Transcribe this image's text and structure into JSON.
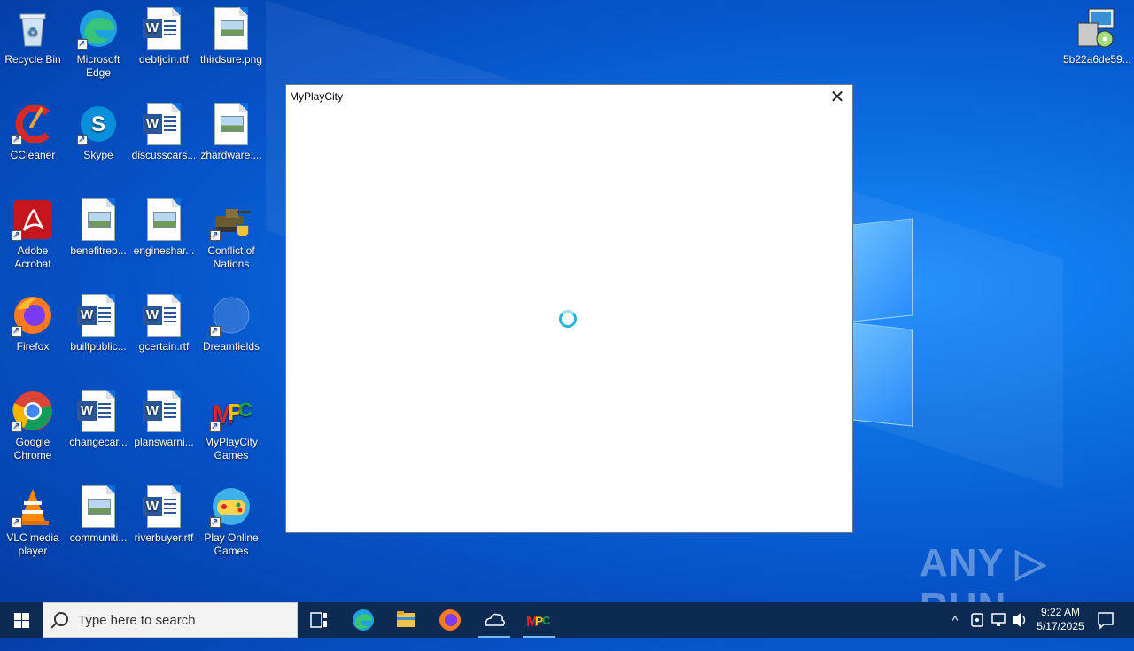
{
  "desktop": {
    "icons": [
      {
        "label": "Recycle Bin"
      },
      {
        "label": "Microsoft Edge"
      },
      {
        "label": "debtjoin.rtf"
      },
      {
        "label": "thirdsure.png"
      },
      {
        "label": "CCleaner"
      },
      {
        "label": "Skype"
      },
      {
        "label": "discusscars..."
      },
      {
        "label": "zhardware...."
      },
      {
        "label": "Adobe Acrobat"
      },
      {
        "label": "benefitrep..."
      },
      {
        "label": "engineshar..."
      },
      {
        "label": "Conflict of Nations"
      },
      {
        "label": "Firefox"
      },
      {
        "label": "builtpublic..."
      },
      {
        "label": "gcertain.rtf"
      },
      {
        "label": "Dreamfields"
      },
      {
        "label": "Google Chrome"
      },
      {
        "label": "changecar..."
      },
      {
        "label": "planswarni..."
      },
      {
        "label": "MyPlayCity Games"
      },
      {
        "label": "VLC media player"
      },
      {
        "label": "communiti..."
      },
      {
        "label": "riverbuyer.rtf"
      },
      {
        "label": "Play Online Games"
      },
      {
        "label": "5b22a6de59..."
      }
    ]
  },
  "dialog": {
    "title": "MyPlayCity",
    "close_glyph": "✕"
  },
  "watermark": "ANY ▷ RUN",
  "taskbar": {
    "search_placeholder": "Type here to search",
    "time": "9:22 AM",
    "date": "5/17/2025",
    "tray_chevron": "^"
  },
  "colors": {
    "desktop_accent": "#0a6fe0",
    "taskbar": "#0c2a52",
    "word_blue": "#2b5797"
  }
}
